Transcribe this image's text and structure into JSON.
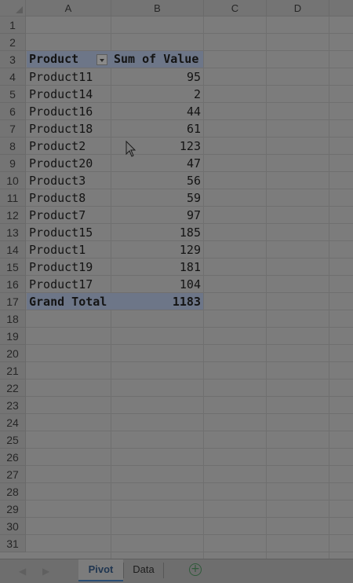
{
  "columns": [
    "A",
    "B",
    "C",
    "D"
  ],
  "rows": [
    "1",
    "2",
    "3",
    "4",
    "5",
    "6",
    "7",
    "8",
    "9",
    "10",
    "11",
    "12",
    "13",
    "14",
    "15",
    "16",
    "17",
    "18",
    "19",
    "20",
    "21",
    "22",
    "23",
    "24",
    "25",
    "26",
    "27",
    "28",
    "29",
    "30",
    "31"
  ],
  "pivot": {
    "header": {
      "product": "Product",
      "sum": "Sum of Value"
    },
    "items": [
      {
        "product": "Product11",
        "value": "95"
      },
      {
        "product": "Product14",
        "value": "2"
      },
      {
        "product": "Product16",
        "value": "44"
      },
      {
        "product": "Product18",
        "value": "61"
      },
      {
        "product": "Product2",
        "value": "123"
      },
      {
        "product": "Product20",
        "value": "47"
      },
      {
        "product": "Product3",
        "value": "56"
      },
      {
        "product": "Product8",
        "value": "59"
      },
      {
        "product": "Product7",
        "value": "97"
      },
      {
        "product": "Product15",
        "value": "185"
      },
      {
        "product": "Product1",
        "value": "129"
      },
      {
        "product": "Product19",
        "value": "181"
      },
      {
        "product": "Product17",
        "value": "104"
      }
    ],
    "grand_total": {
      "label": "Grand Total",
      "value": "1183"
    }
  },
  "sheet_tabs": [
    {
      "name": "Pivot",
      "active": true
    },
    {
      "name": "Data",
      "active": false
    }
  ],
  "icons": {
    "add_sheet": "plus-circle-icon",
    "filter": "dropdown-arrow-icon",
    "cursor": "mouse-pointer-icon"
  },
  "colors": {
    "pivot_header_band": "#6d7688",
    "active_tab_underline": "#2b4d73",
    "add_sheet": "#2f5a3a"
  }
}
